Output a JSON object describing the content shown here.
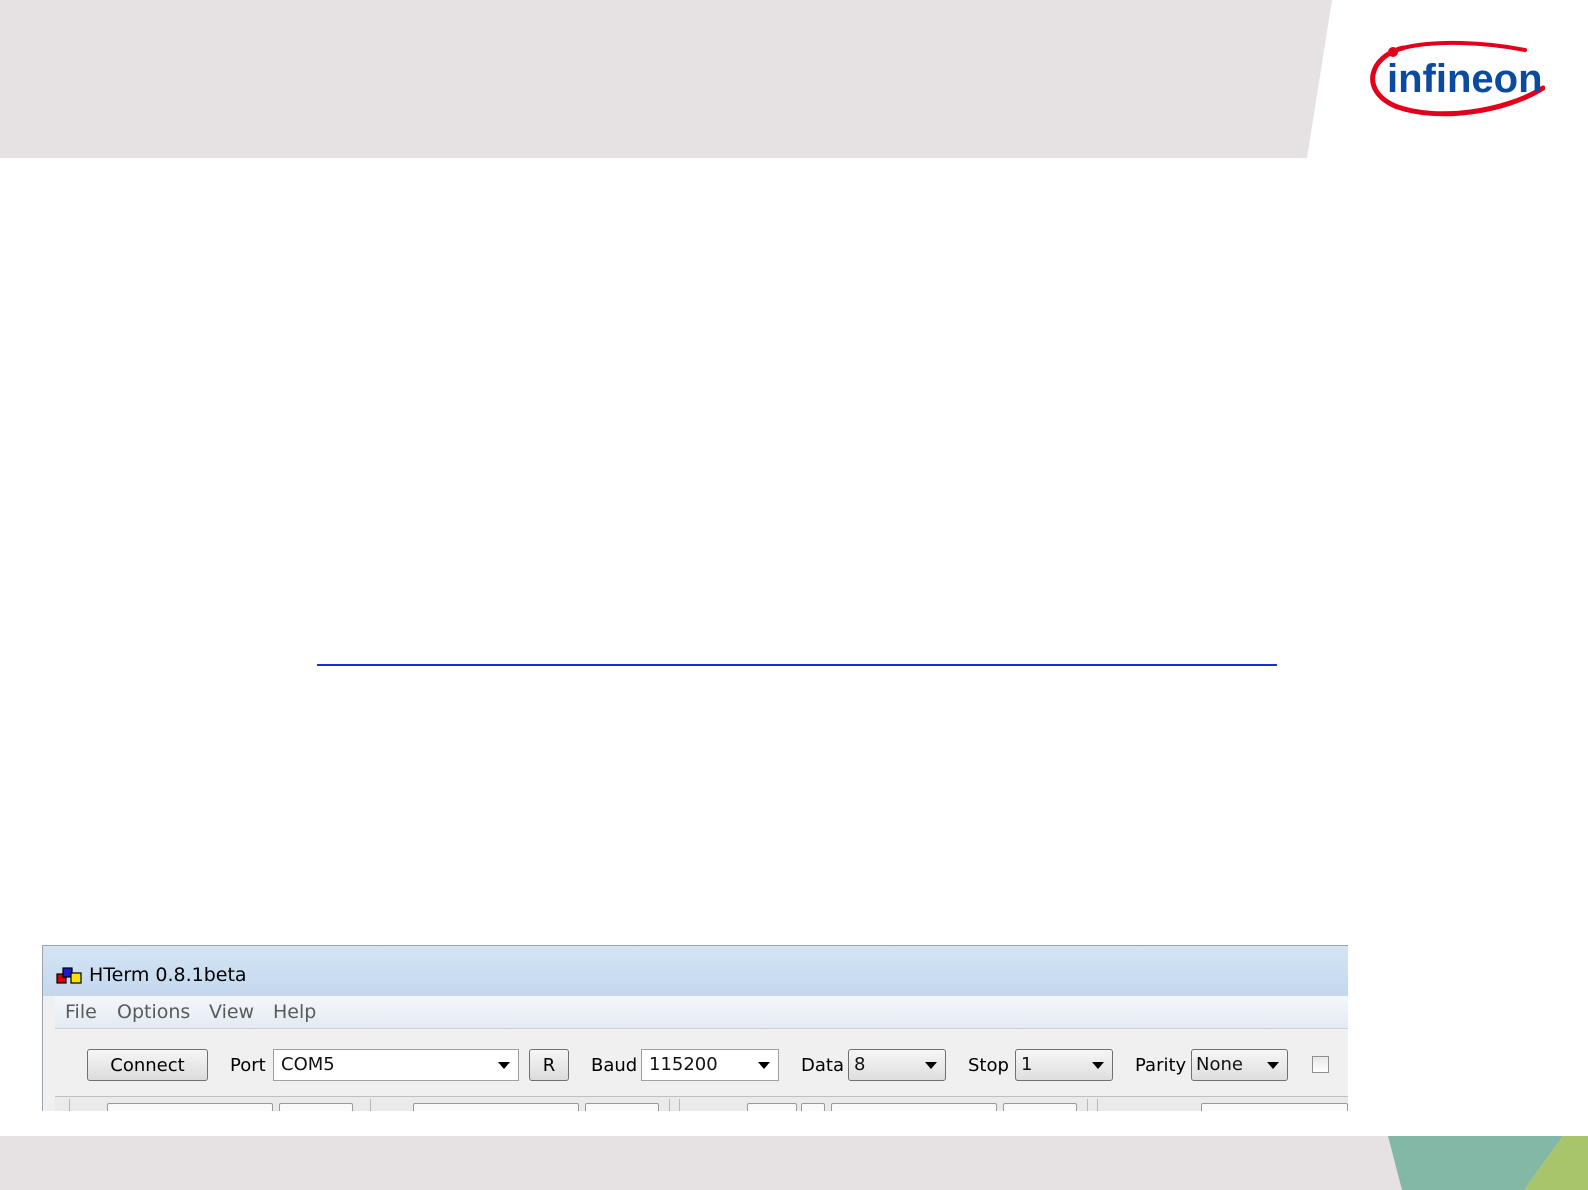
{
  "slide": {
    "brand": "infineon",
    "colors": {
      "band": "#e6e1e2",
      "logo_red": "#e2001a",
      "logo_blue": "#0a4aa0",
      "link": "#1f2bd4",
      "footer_teal": "#84b8a6",
      "footer_green": "#a9c56b"
    }
  },
  "hterm": {
    "title": "HTerm 0.8.1beta",
    "menu": [
      "File",
      "Options",
      "View",
      "Help"
    ],
    "toolbar": {
      "connect_label": "Connect",
      "port_label": "Port",
      "port_value": "COM5",
      "refresh_label": "R",
      "baud_label": "Baud",
      "baud_value": "115200",
      "data_label": "Data",
      "data_value": "8",
      "stop_label": "Stop",
      "stop_value": "1",
      "parity_label": "Parity",
      "parity_value": "None"
    }
  }
}
